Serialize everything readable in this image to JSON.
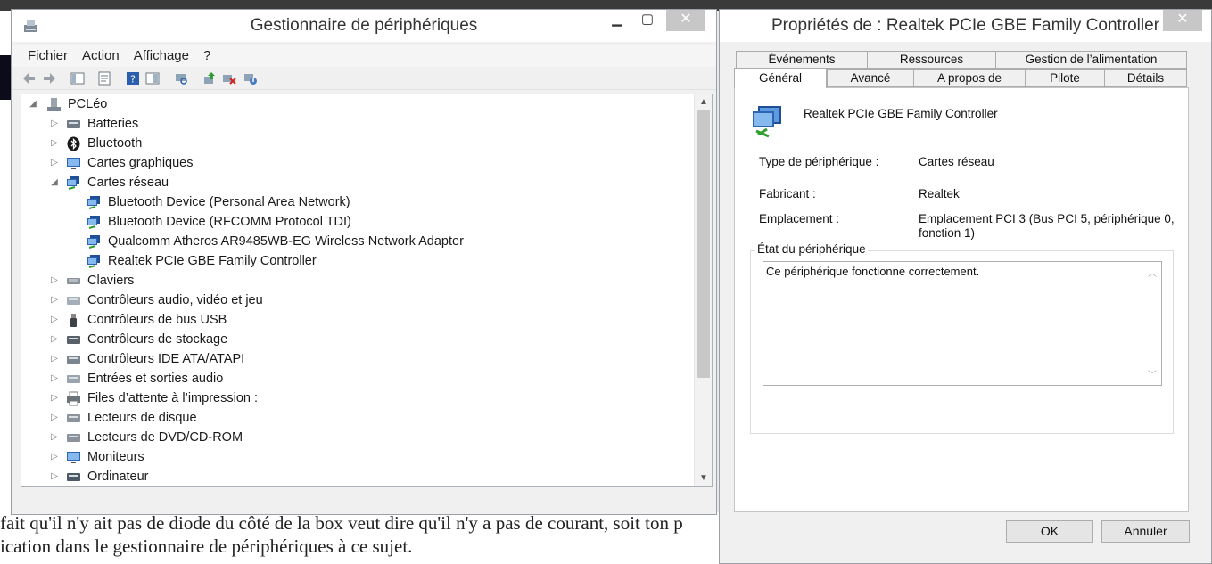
{
  "device_manager": {
    "title": "Gestionnaire de périphériques",
    "minimize": "▁",
    "maximize": "▢",
    "close": "✕",
    "menu": [
      "Fichier",
      "Action",
      "Affichage",
      "?"
    ],
    "toolbar_icons": [
      "back-icon",
      "forward-icon",
      "show-hide-tree-icon",
      "properties-icon",
      "help-icon",
      "show-hide-action-pane-icon",
      "scan-hardware-icon",
      "update-driver-icon",
      "uninstall-icon",
      "disable-device-icon"
    ],
    "tree": {
      "root": "PCLéo",
      "items": [
        {
          "label": "Batteries",
          "icon": "battery-icon",
          "expanded": false
        },
        {
          "label": "Bluetooth",
          "icon": "bluetooth-icon",
          "expanded": false
        },
        {
          "label": "Cartes graphiques",
          "icon": "display-adapter-icon",
          "expanded": false
        },
        {
          "label": "Cartes réseau",
          "icon": "network-adapter-icon",
          "expanded": true,
          "children": [
            "Bluetooth Device (Personal Area Network)",
            "Bluetooth Device (RFCOMM Protocol TDI)",
            "Qualcomm Atheros AR9485WB-EG Wireless Network Adapter",
            "Realtek PCIe GBE Family Controller"
          ]
        },
        {
          "label": "Claviers",
          "icon": "keyboard-icon",
          "expanded": false
        },
        {
          "label": "Contrôleurs audio, vidéo et jeu",
          "icon": "speaker-icon",
          "expanded": false
        },
        {
          "label": "Contrôleurs de bus USB",
          "icon": "usb-icon",
          "expanded": false
        },
        {
          "label": "Contrôleurs de stockage",
          "icon": "storage-controller-icon",
          "expanded": false
        },
        {
          "label": "Contrôleurs IDE ATA/ATAPI",
          "icon": "ide-controller-icon",
          "expanded": false
        },
        {
          "label": "Entrées et sorties audio",
          "icon": "audio-io-icon",
          "expanded": false
        },
        {
          "label": "Files d’attente à l’impression :",
          "icon": "printer-icon",
          "expanded": false
        },
        {
          "label": "Lecteurs de disque",
          "icon": "disk-drive-icon",
          "expanded": false
        },
        {
          "label": "Lecteurs de DVD/CD-ROM",
          "icon": "dvd-drive-icon",
          "expanded": false
        },
        {
          "label": "Moniteurs",
          "icon": "monitor-icon",
          "expanded": false
        },
        {
          "label": "Ordinateur",
          "icon": "computer-icon",
          "expanded": false
        }
      ]
    }
  },
  "properties": {
    "title": "Propriétés de : Realtek PCIe GBE Family Controller",
    "close": "✕",
    "tabs_row1": [
      "Événements",
      "Ressources",
      "Gestion de l’alimentation"
    ],
    "tabs_row2": [
      "Général",
      "Avancé",
      "A propos de",
      "Pilote",
      "Détails"
    ],
    "selected_tab": "Général",
    "device_name": "Realtek PCIe GBE Family Controller",
    "type_label": "Type de périphérique :",
    "type_value": "Cartes réseau",
    "manufacturer_label": "Fabricant :",
    "manufacturer_value": "Realtek",
    "location_label": "Emplacement :",
    "location_value_line1": "Emplacement PCI 3 (Bus PCI 5, périphérique 0,",
    "location_value_line2": "fonction 1)",
    "status_group_label": "État du périphérique",
    "status_text": "Ce périphérique fonctionne correctement.",
    "ok_label": "OK",
    "cancel_label": "Annuler"
  },
  "background": {
    "bottom_line1": "fait qu'il n'y ait pas de diode du côté de la box veut dire qu'il n'y a pas de courant, soit ton p",
    "bottom_line2": "ication dans le gestionnaire de périphériques à ce sujet."
  },
  "colors": {
    "window_bg": "#f0f0f0",
    "titlebar_bg": "#ffffff",
    "close_button": "#c7c7c7",
    "tree_bg": "#ffffff"
  }
}
